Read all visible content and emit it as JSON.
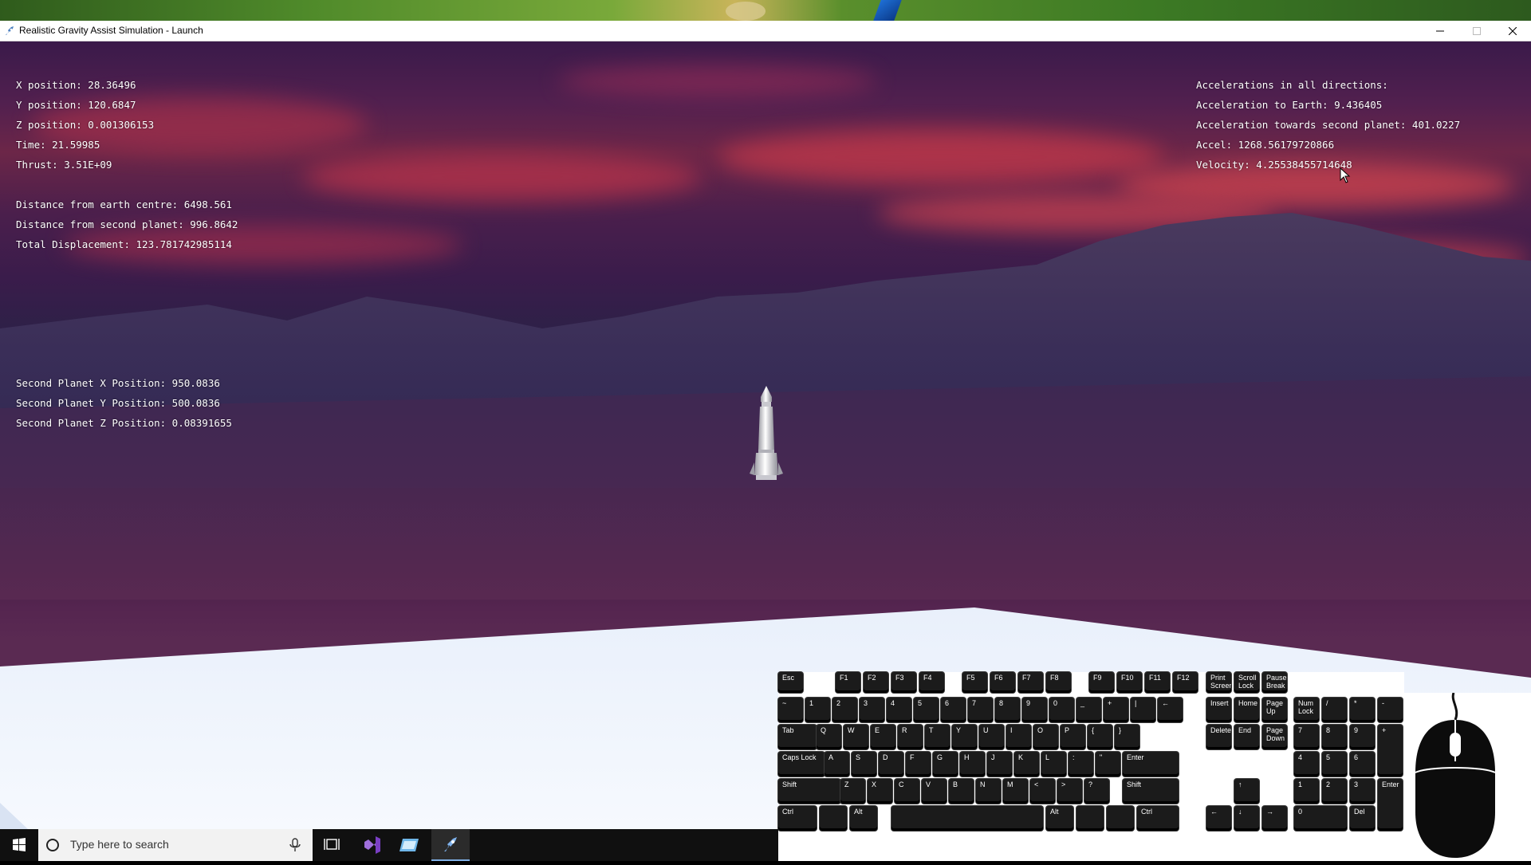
{
  "window": {
    "title": "Realistic Gravity Assist Simulation - Launch",
    "controls": {
      "minimize": "—",
      "maximize": "☐",
      "close": "✕"
    }
  },
  "hud": {
    "position": [
      "X position: 28.36496",
      "Y position: 120.6847",
      "Z position: 0.001306153",
      "Time: 21.59985",
      "Thrust: 3.51E+09"
    ],
    "distances": [
      "Distance from earth centre: 6498.561",
      "Distance from second planet: 996.8642",
      "Total Displacement: 123.781742985114"
    ],
    "second_planet": [
      "Second Planet X Position: 950.0836",
      "Second Planet Y Position: 500.0836",
      "Second Planet Z Position: 0.08391655"
    ],
    "accelerations": [
      "Accelerations in all directions:",
      "Acceleration to Earth: 9.436405",
      "Acceleration towards second planet: 401.0227",
      "Accel: 1268.56179720866",
      "Velocity: 4.25538455714648"
    ]
  },
  "keyboard": {
    "row0": [
      "Esc",
      "F1",
      "F2",
      "F3",
      "F4",
      "F5",
      "F6",
      "F7",
      "F8",
      "F9",
      "F10",
      "F11",
      "F12",
      "Print Screen",
      "Scroll Lock",
      "Pause Break"
    ],
    "row1": [
      "~",
      "1",
      "2",
      "3",
      "4",
      "5",
      "6",
      "7",
      "8",
      "9",
      "0",
      "_",
      "+",
      "|",
      "←",
      "Insert",
      "Home",
      "Page Up",
      "Num Lock",
      "/",
      "*",
      "-"
    ],
    "row2": [
      "Tab",
      "Q",
      "W",
      "E",
      "R",
      "T",
      "Y",
      "U",
      "I",
      "O",
      "P",
      "{",
      "}",
      "Delete",
      "End",
      "Page Down",
      "7",
      "8",
      "9",
      "+"
    ],
    "row3": [
      "Caps Lock",
      "A",
      "S",
      "D",
      "F",
      "G",
      "H",
      "J",
      "K",
      "L",
      ":",
      "\"",
      "Enter",
      "4",
      "5",
      "6"
    ],
    "row4": [
      "Shift",
      "Z",
      "X",
      "C",
      "V",
      "B",
      "N",
      "M",
      "<",
      ">",
      "?",
      "Shift",
      "↑",
      "1",
      "2",
      "3",
      "Enter"
    ],
    "row5": [
      "Ctrl",
      "",
      "Alt",
      "",
      "Alt",
      "",
      "",
      "Ctrl",
      "←",
      "↓",
      "→",
      "0",
      "Del"
    ]
  },
  "taskbar": {
    "search_placeholder": "Type here to search"
  },
  "icons": {
    "start": "windows-logo-icon",
    "search": "search-circle-icon",
    "mic": "microphone-icon",
    "taskview": "task-view-icon",
    "apps": [
      "visual-studio-icon",
      "app-window-icon",
      "simulation-app-icon"
    ]
  }
}
